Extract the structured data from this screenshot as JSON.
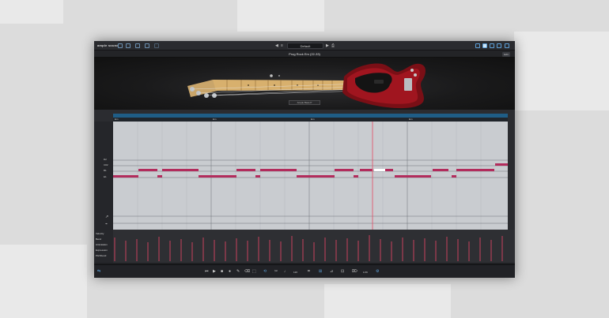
{
  "app": {
    "logo": "ample sound",
    "preset": "Default",
    "title": "Prog Rock Em (22-33)",
    "edit_label": "Edit",
    "stage_label": "Ample Bass P"
  },
  "timeline": {
    "chords": [
      "Em",
      "Em",
      "Em",
      "Em"
    ]
  },
  "keys": [
    "D2",
    "C#2",
    "B1",
    "E1"
  ],
  "lanes": [
    "Velocity",
    "Bend",
    "Articulation",
    "Expression",
    "Pitchbend"
  ],
  "toolbar": {
    "tempo": "120",
    "zoom": "1/16"
  },
  "colors": {
    "accent": "#1f5d86",
    "note": "#b22c5c",
    "playhead": "#e64a63"
  },
  "icons": [
    "undo-icon",
    "redo-icon",
    "save-icon",
    "settings-icon",
    "play-icon",
    "stop-icon",
    "record-icon",
    "metronome-icon"
  ]
}
